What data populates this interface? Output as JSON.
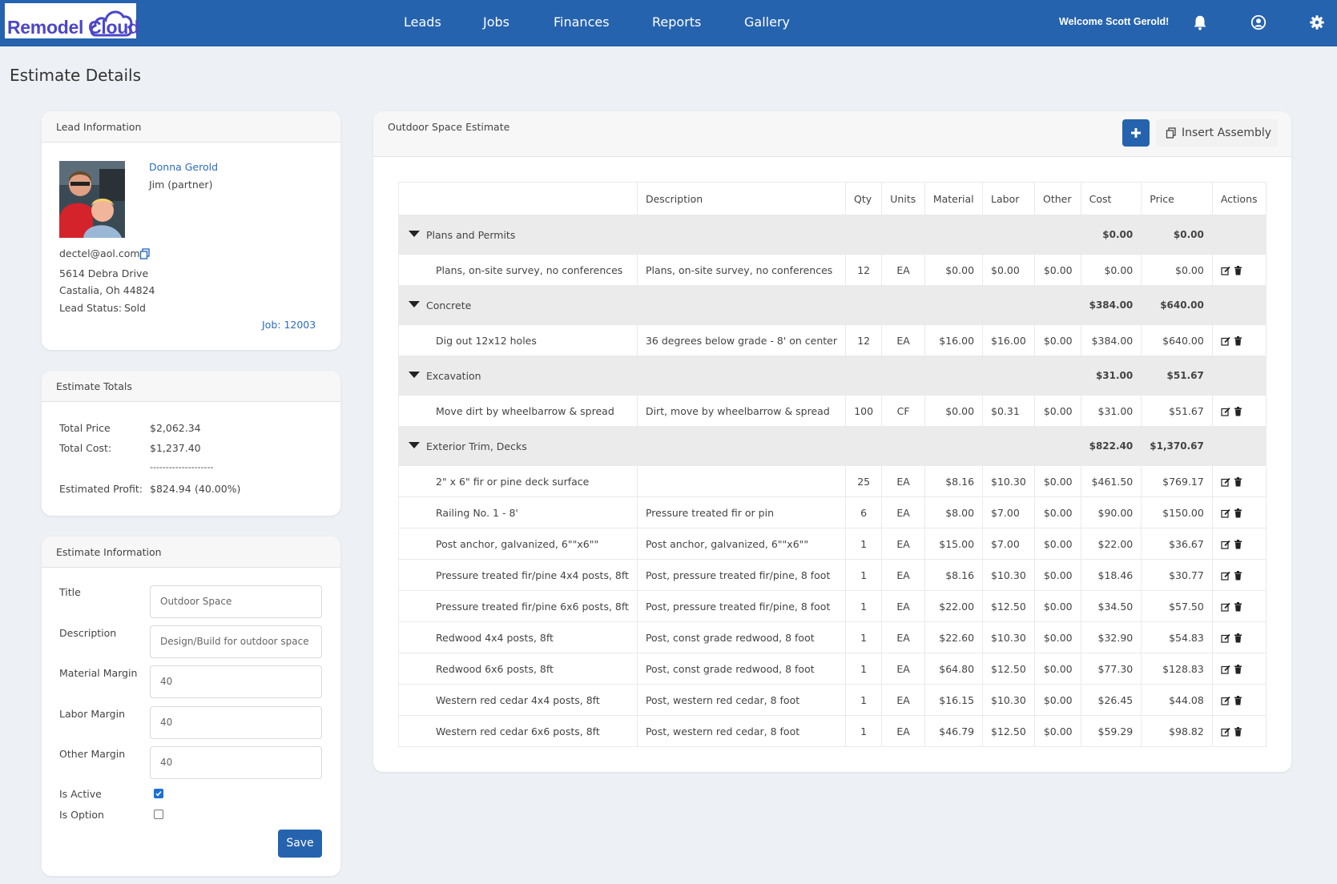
{
  "header": {
    "logo_text": "Remodel Cloud",
    "nav": [
      "Leads",
      "Jobs",
      "Finances",
      "Reports",
      "Gallery"
    ],
    "welcome": "Welcome Scott Gerold!",
    "icons": [
      "bell-icon",
      "user-circle-icon",
      "gear-icon"
    ],
    "brand_color": "#2563ae"
  },
  "page_title": "Estimate Details",
  "lead": {
    "header": "Lead Information",
    "name": "Donna Gerold",
    "partner": "Jim (partner)",
    "email": "dectel@aol.com",
    "address1": "5614 Debra Drive",
    "address2": "Castalia, Oh 44824",
    "status_label": "Lead Status:",
    "status_value": "Sold",
    "job_link": "Job: 12003"
  },
  "totals": {
    "header": "Estimate Totals",
    "price_label": "Total Price",
    "price_value": "$2,062.34",
    "cost_label": "Total Cost:",
    "cost_value": "$1,237.40",
    "divider": "--------------------",
    "profit_label": "Estimated Profit:",
    "profit_value": "$824.94",
    "profit_pct": "(40.00%)"
  },
  "info": {
    "header": "Estimate Information",
    "title_label": "Title",
    "title_value": "Outdoor Space",
    "description_label": "Description",
    "description_value": "Design/Build for outdoor space",
    "material_margin_label": "Material Margin",
    "material_margin_value": "40",
    "labor_margin_label": "Labor Margin",
    "labor_margin_value": "40",
    "other_margin_label": "Other Margin",
    "other_margin_value": "40",
    "is_active_label": "Is Active",
    "is_active": true,
    "is_option_label": "Is Option",
    "is_option": false,
    "save_label": "Save"
  },
  "estimate": {
    "header": "Outdoor Space Estimate",
    "insert_label": "Insert Assembly",
    "columns": [
      "",
      "Description",
      "Qty",
      "Units",
      "Material",
      "Labor",
      "Other",
      "Cost",
      "Price",
      "Actions"
    ],
    "groups": [
      {
        "name": "Plans and Permits",
        "cost": "$0.00",
        "price": "$0.00",
        "items": [
          {
            "name": "Plans, on-site survey, no conferences",
            "description": "Plans, on-site survey, no conferences",
            "qty": "12",
            "units": "EA",
            "material": "$0.00",
            "labor": "$0.00",
            "other": "$0.00",
            "cost": "$0.00",
            "price": "$0.00"
          }
        ]
      },
      {
        "name": "Concrete",
        "cost": "$384.00",
        "price": "$640.00",
        "items": [
          {
            "name": "Dig out 12x12 holes",
            "description": "36 degrees below grade - 8' on center",
            "qty": "12",
            "units": "EA",
            "material": "$16.00",
            "labor": "$16.00",
            "other": "$0.00",
            "cost": "$384.00",
            "price": "$640.00"
          }
        ]
      },
      {
        "name": "Excavation",
        "cost": "$31.00",
        "price": "$51.67",
        "items": [
          {
            "name": "Move dirt by wheelbarrow & spread",
            "description": "Dirt, move by wheelbarrow & spread",
            "qty": "100",
            "units": "CF",
            "material": "$0.00",
            "labor": "$0.31",
            "other": "$0.00",
            "cost": "$31.00",
            "price": "$51.67"
          }
        ]
      },
      {
        "name": "Exterior Trim, Decks",
        "cost": "$822.40",
        "price": "$1,370.67",
        "items": [
          {
            "name": "2\" x 6\" fir or pine deck surface",
            "description": "",
            "qty": "25",
            "units": "EA",
            "material": "$8.16",
            "labor": "$10.30",
            "other": "$0.00",
            "cost": "$461.50",
            "price": "$769.17"
          },
          {
            "name": "Railing No. 1 - 8'",
            "description": "Pressure treated fir or pin",
            "qty": "6",
            "units": "EA",
            "material": "$8.00",
            "labor": "$7.00",
            "other": "$0.00",
            "cost": "$90.00",
            "price": "$150.00"
          },
          {
            "name": "Post anchor, galvanized, 6\"\"x6\"\"",
            "description": "Post anchor, galvanized, 6\"\"x6\"\"",
            "qty": "1",
            "units": "EA",
            "material": "$15.00",
            "labor": "$7.00",
            "other": "$0.00",
            "cost": "$22.00",
            "price": "$36.67"
          },
          {
            "name": "Pressure treated fir/pine 4x4 posts, 8ft",
            "description": "Post, pressure treated fir/pine, 8 foot",
            "qty": "1",
            "units": "EA",
            "material": "$8.16",
            "labor": "$10.30",
            "other": "$0.00",
            "cost": "$18.46",
            "price": "$30.77"
          },
          {
            "name": "Pressure treated fir/pine 6x6 posts, 8ft",
            "description": "Post, pressure treated fir/pine, 8 foot",
            "qty": "1",
            "units": "EA",
            "material": "$22.00",
            "labor": "$12.50",
            "other": "$0.00",
            "cost": "$34.50",
            "price": "$57.50"
          },
          {
            "name": "Redwood 4x4 posts, 8ft",
            "description": "Post, const grade redwood, 8 foot",
            "qty": "1",
            "units": "EA",
            "material": "$22.60",
            "labor": "$10.30",
            "other": "$0.00",
            "cost": "$32.90",
            "price": "$54.83"
          },
          {
            "name": "Redwood 6x6 posts, 8ft",
            "description": "Post, const grade redwood, 8 foot",
            "qty": "1",
            "units": "EA",
            "material": "$64.80",
            "labor": "$12.50",
            "other": "$0.00",
            "cost": "$77.30",
            "price": "$128.83"
          },
          {
            "name": "Western red cedar 4x4 posts, 8ft",
            "description": "Post, western red cedar, 8 foot",
            "qty": "1",
            "units": "EA",
            "material": "$16.15",
            "labor": "$10.30",
            "other": "$0.00",
            "cost": "$26.45",
            "price": "$44.08"
          },
          {
            "name": "Western red cedar 6x6 posts, 8ft",
            "description": "Post, western red cedar, 8 foot",
            "qty": "1",
            "units": "EA",
            "material": "$46.79",
            "labor": "$12.50",
            "other": "$0.00",
            "cost": "$59.29",
            "price": "$98.82"
          }
        ]
      }
    ]
  }
}
